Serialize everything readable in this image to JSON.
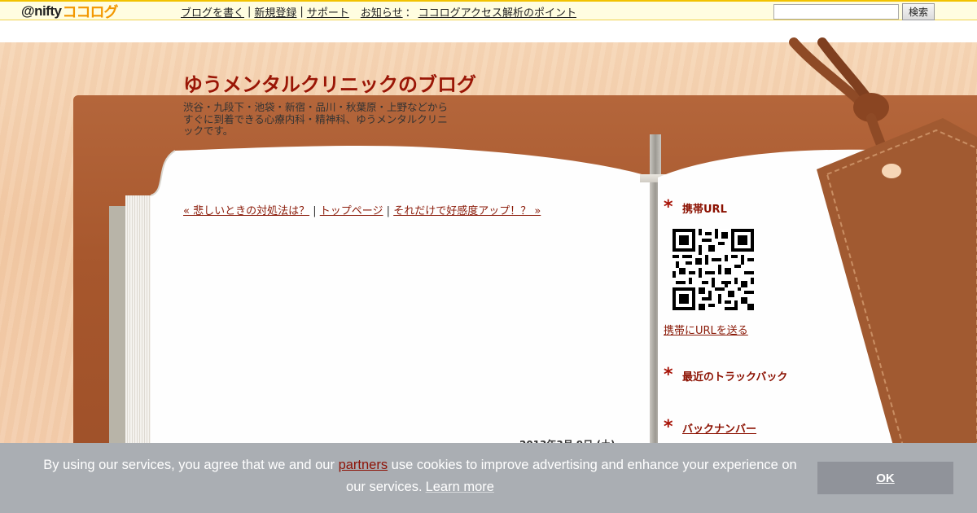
{
  "topbar": {
    "logo_prefix": "@nifty",
    "logo_brand": "ココログ",
    "nav": {
      "write": "ブログを書く",
      "register": "新規登録",
      "support": "サポート",
      "news_label": "お知らせ",
      "news_link": "ココログアクセス解析のポイント"
    },
    "search_value": "",
    "search_button": "検索"
  },
  "blog": {
    "title": "ゆうメンタルクリニックのブログ",
    "description": "渋谷・九段下・池袋・新宿・品川・秋葉原・上野などからすぐに到着できる心療内科・精神科、ゆうメンタルクリニックです。"
  },
  "post_nav": {
    "prev": "« 悲しいときの対処法は？",
    "sep": "|",
    "top": "トップページ",
    "next": "それだけで好感度アップ！？ »"
  },
  "post": {
    "date": "2013年3月 9日 (土)"
  },
  "sidebar": {
    "star": "*",
    "mobile_url_heading": "携帯URL",
    "mobile_url_link": "携帯にURLを送る",
    "trackback_heading": "最近のトラックバック",
    "backnumber_heading": "バックナンバー"
  },
  "cookie": {
    "text_before": "By using our services, you agree that we and our ",
    "partners": "partners",
    "text_after": " use cookies to improve advertising and enhance your experience on our services.",
    "learn_more": "Learn more",
    "ok": "OK"
  },
  "colors": {
    "accent_red": "#9a1606",
    "link_red": "#8a1a08",
    "topbar_bg": "#fffde0",
    "leather": "#a7572d",
    "cookie_bg": "#aaaeb3"
  }
}
